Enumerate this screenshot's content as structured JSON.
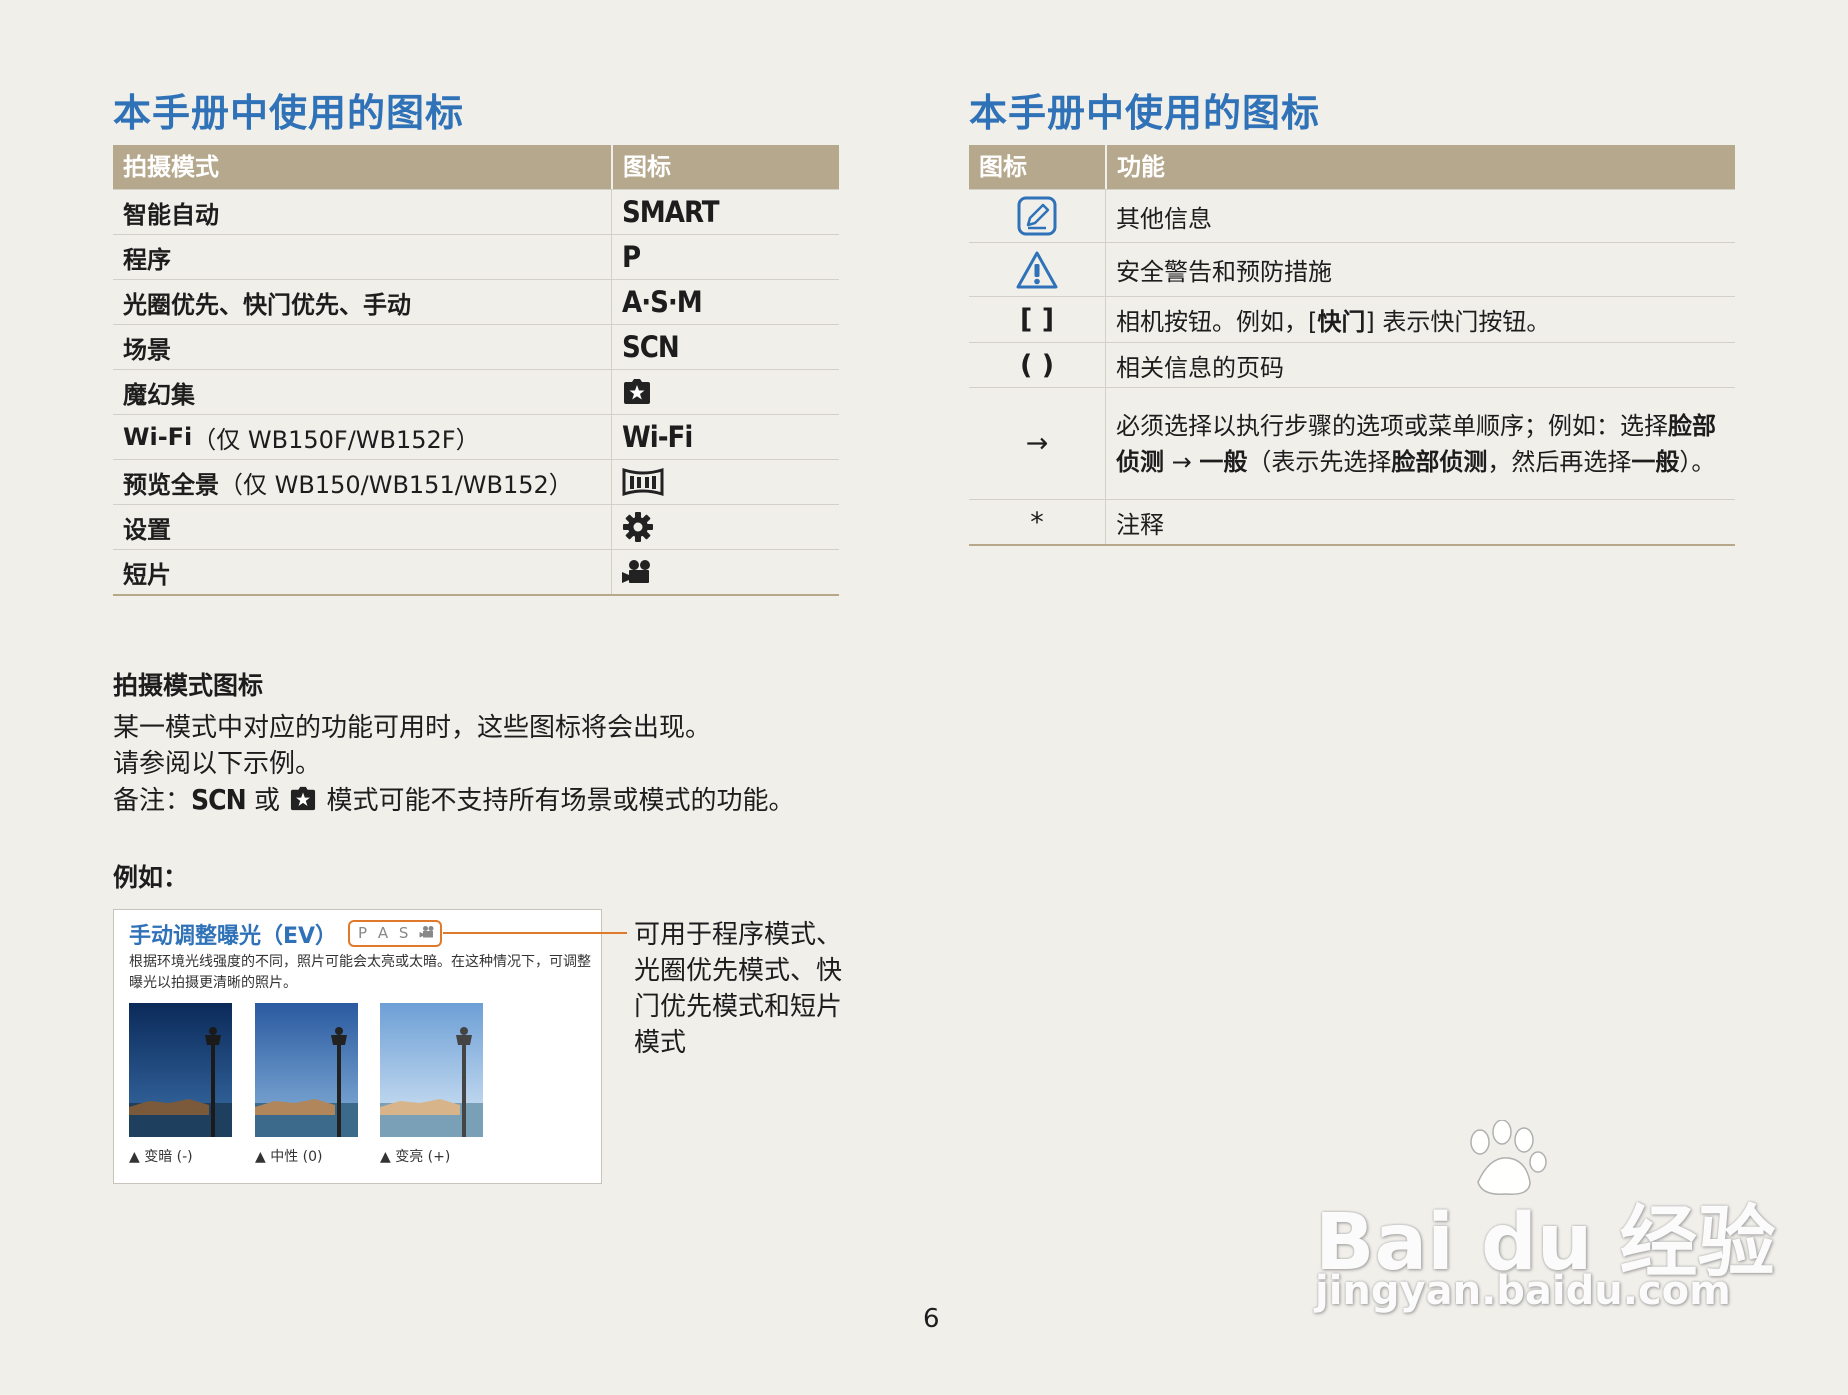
{
  "left": {
    "heading": "本手册中使用的图标",
    "table": {
      "headers": [
        "拍摄模式",
        "图标"
      ],
      "rows": [
        {
          "mode": "智能自动",
          "mode_note": "",
          "icon_text": "SMART",
          "icon": ""
        },
        {
          "mode": "程序",
          "mode_note": "",
          "icon_text": "P",
          "icon": ""
        },
        {
          "mode": "光圈优先、快门优先、手动",
          "mode_note": "",
          "icon_text": "A·S·M",
          "icon": ""
        },
        {
          "mode": "场景",
          "mode_note": "",
          "icon_text": "SCN",
          "icon": ""
        },
        {
          "mode": "魔幻集",
          "mode_note": "",
          "icon_text": "",
          "icon": "magic-star-icon"
        },
        {
          "mode": "Wi-Fi",
          "mode_note": "（仅 WB150F/WB152F）",
          "icon_text": "Wi-Fi",
          "icon": ""
        },
        {
          "mode": "预览全景",
          "mode_note": "（仅 WB150/WB151/WB152）",
          "icon_text": "",
          "icon": "panorama-icon"
        },
        {
          "mode": "设置",
          "mode_note": "",
          "icon_text": "",
          "icon": "gear-icon"
        },
        {
          "mode": "短片",
          "mode_note": "",
          "icon_text": "",
          "icon": "movie-camera-icon"
        }
      ]
    },
    "mode_icons_title": "拍摄模式图标",
    "mode_icons_line1": "某一模式中对应的功能可用时，这些图标将会出现。",
    "mode_icons_line2": "请参阅以下示例。",
    "note_prefix": "备注：",
    "note_scn": "SCN",
    "note_or": "或",
    "note_suffix": "模式可能不支持所有场景或模式的功能。",
    "example_label": "例如：",
    "example": {
      "title": "手动调整曝光（EV）",
      "badge": "P A S",
      "description": "根据环境光线强度的不同，照片可能会太亮或太暗。在这种情况下，可调整曝光以拍摄更清晰的照片。",
      "captions": [
        "▲ 变暗 (-)",
        "▲ 中性 (0)",
        "▲ 变亮 (+)"
      ]
    },
    "callout": "可用于程序模式、光圈优先模式、快门优先模式和短片模式"
  },
  "right": {
    "heading": "本手册中使用的图标",
    "table": {
      "headers": [
        "图标",
        "功能"
      ],
      "rows": [
        {
          "icon": "note-pencil-icon",
          "symbol": ""
        },
        {
          "icon": "warning-triangle-icon",
          "symbol": ""
        },
        {
          "icon": "",
          "symbol": "[ ]"
        },
        {
          "icon": "",
          "symbol": "( )"
        },
        {
          "icon": "",
          "symbol": "→"
        },
        {
          "icon": "",
          "symbol": "*"
        }
      ],
      "r0": "其他信息",
      "r1": "安全警告和预防措施",
      "r2_a": "相机按钮。例如，[",
      "r2_b": "快门",
      "r2_c": "] 表示快门按钮。",
      "r3": "相关信息的页码",
      "r4_a": "必须选择以执行步骤的选项或菜单顺序；例如：选择",
      "r4_b": "脸部侦测",
      "r4_c": " → ",
      "r4_d": "一般",
      "r4_e": "（表示先选择",
      "r4_f": "脸部侦测",
      "r4_g": "，然后再选择",
      "r4_h": "一般",
      "r4_i": "）。",
      "r5": "注释"
    }
  },
  "page_number": "6",
  "watermark": {
    "brand": "Bai du 经验",
    "url": "jingyan.baidu.com"
  },
  "colors": {
    "heading_blue": "#2f72b8",
    "table_header": "#b6a88c",
    "callout_orange": "#e07a2a",
    "background": "#f1efea"
  }
}
